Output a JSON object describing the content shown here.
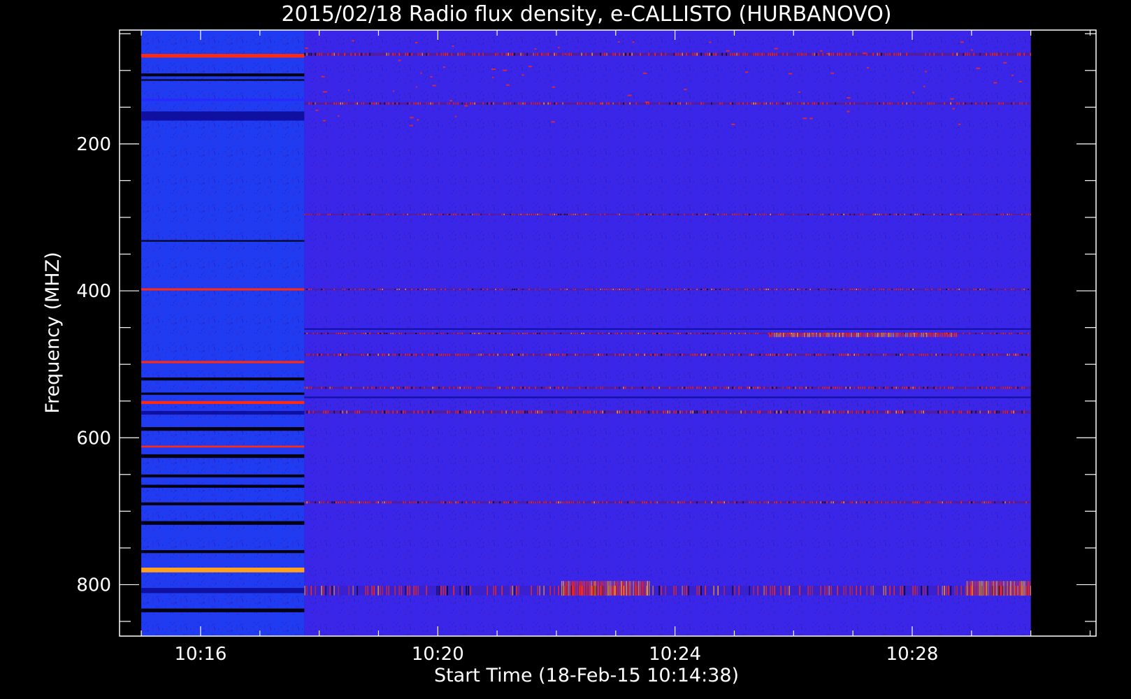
{
  "chart_data": {
    "type": "heatmap",
    "title": "2015/02/18  Radio flux density, e-CALLISTO (HURBANOVO)",
    "xlabel": "Start Time (18-Feb-15 10:14:38)",
    "ylabel": "Frequency (MHZ)",
    "x_unit": "minutes",
    "xlim": [
      "10:14:38",
      "10:31:06"
    ],
    "ylim": [
      45,
      870
    ],
    "y_inverted": true,
    "x_ticks": [
      "10:16",
      "10:20",
      "10:24",
      "10:28"
    ],
    "y_ticks": [
      200,
      400,
      600,
      800
    ],
    "data_extent": {
      "t_start": "10:15",
      "t_end": "10:30",
      "f_min": 45,
      "f_max": 870
    },
    "segment_change_time": "10:17:45",
    "colors": {
      "background": "#000000",
      "frame": "#ffffff",
      "low": "#1010a0",
      "mid": "#2828ff",
      "high": "#ff2a10",
      "peak": "#ffa020"
    },
    "segment_1": {
      "base_color": "#1f3cf2",
      "bands": [
        {
          "f": 80,
          "w": 10,
          "level": "high"
        },
        {
          "f": 106,
          "w": 8,
          "level": "black"
        },
        {
          "f": 113,
          "w": 4,
          "level": "black"
        },
        {
          "f": 140,
          "w": 6,
          "level": "mid"
        },
        {
          "f": 162,
          "w": 25,
          "level": "dark"
        },
        {
          "f": 332,
          "w": 4,
          "level": "black"
        },
        {
          "f": 398,
          "w": 6,
          "level": "high"
        },
        {
          "f": 497,
          "w": 6,
          "level": "high"
        },
        {
          "f": 520,
          "w": 8,
          "level": "black"
        },
        {
          "f": 540,
          "w": 6,
          "level": "black"
        },
        {
          "f": 552,
          "w": 8,
          "level": "high"
        },
        {
          "f": 566,
          "w": 10,
          "level": "dark"
        },
        {
          "f": 588,
          "w": 10,
          "level": "black"
        },
        {
          "f": 612,
          "w": 5,
          "level": "high"
        },
        {
          "f": 625,
          "w": 10,
          "level": "black"
        },
        {
          "f": 652,
          "w": 8,
          "level": "black"
        },
        {
          "f": 666,
          "w": 8,
          "level": "black"
        },
        {
          "f": 690,
          "w": 8,
          "level": "black"
        },
        {
          "f": 716,
          "w": 10,
          "level": "black"
        },
        {
          "f": 755,
          "w": 8,
          "level": "black"
        },
        {
          "f": 780,
          "w": 13,
          "level": "peak"
        },
        {
          "f": 808,
          "w": 14,
          "level": "dark"
        },
        {
          "f": 835,
          "w": 10,
          "level": "black"
        }
      ]
    },
    "segment_2": {
      "base_color": "#3a26e8",
      "bands": [
        {
          "f": 78,
          "w": 8,
          "level": "high"
        },
        {
          "f": 145,
          "w": 6,
          "level": "high"
        },
        {
          "f": 296,
          "w": 4,
          "level": "high"
        },
        {
          "f": 398,
          "w": 4,
          "level": "high"
        },
        {
          "f": 452,
          "w": 3,
          "level": "dark"
        },
        {
          "f": 458,
          "w": 4,
          "level": "high"
        },
        {
          "f": 487,
          "w": 6,
          "level": "high"
        },
        {
          "f": 532,
          "w": 6,
          "level": "high"
        },
        {
          "f": 545,
          "w": 4,
          "level": "dark"
        },
        {
          "f": 565,
          "w": 8,
          "level": "high"
        },
        {
          "f": 688,
          "w": 6,
          "level": "high"
        },
        {
          "f": 808,
          "w": 26,
          "level": "noise"
        }
      ],
      "hot_patches": [
        {
          "t0": "10:22:05",
          "t1": "10:23:35",
          "f": 805,
          "w": 20
        },
        {
          "t0": "10:25:35",
          "t1": "10:28:45",
          "f": 460,
          "w": 6
        },
        {
          "t0": "10:28:55",
          "t1": "10:30:00",
          "f": 805,
          "w": 20
        }
      ]
    }
  }
}
